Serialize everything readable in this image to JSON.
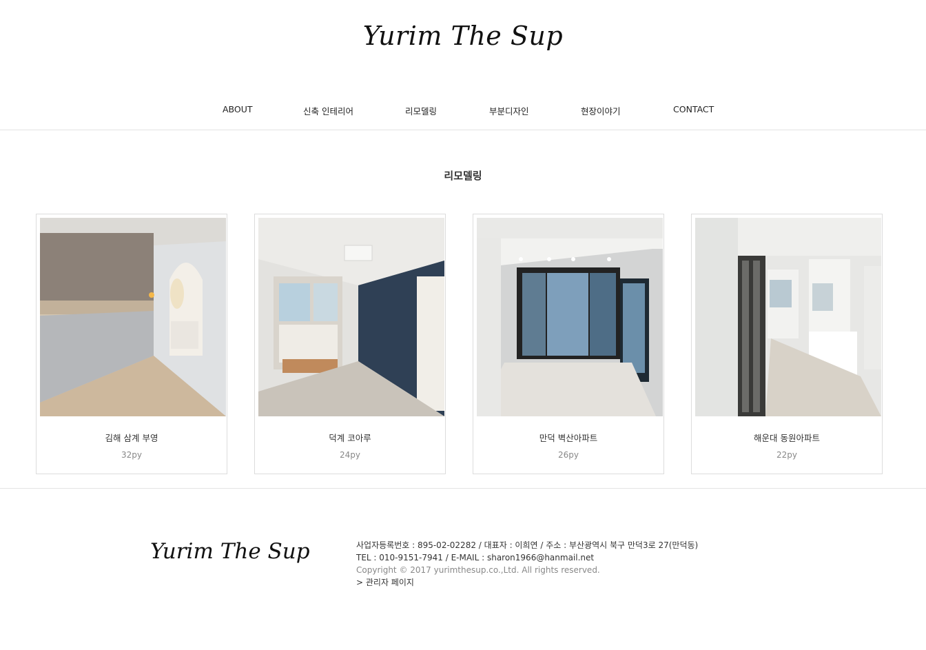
{
  "brand": {
    "logo_text": "Yurim The Sup"
  },
  "nav": {
    "items": [
      {
        "label": "ABOUT"
      },
      {
        "label": "신축 인테리어"
      },
      {
        "label": "리모델링"
      },
      {
        "label": "부분디자인"
      },
      {
        "label": "현장이야기"
      },
      {
        "label": "CONTACT"
      }
    ]
  },
  "main": {
    "title": "리모델링",
    "cards": [
      {
        "title": "김해 삼계 부영",
        "size": "32py"
      },
      {
        "title": "덕계 코아루",
        "size": "24py"
      },
      {
        "title": "만덕 벽산아파트",
        "size": "26py"
      },
      {
        "title": "해운대 동원아파트",
        "size": "22py"
      }
    ]
  },
  "footer": {
    "logo_text": "Yurim The Sup",
    "line1": "사업자등록번호 : 895-02-02282 / 대표자 : 이희연 / 주소 : 부산광역시 북구 만덕3로 27(만덕동)",
    "line2": "TEL : 010-9151-7941 / E-MAIL : sharon1966@hanmail.net",
    "copyright": "Copyright © 2017 yurimthesup.co.,Ltd. All rights reserved.",
    "admin_link": "> 관리자 페이지"
  }
}
